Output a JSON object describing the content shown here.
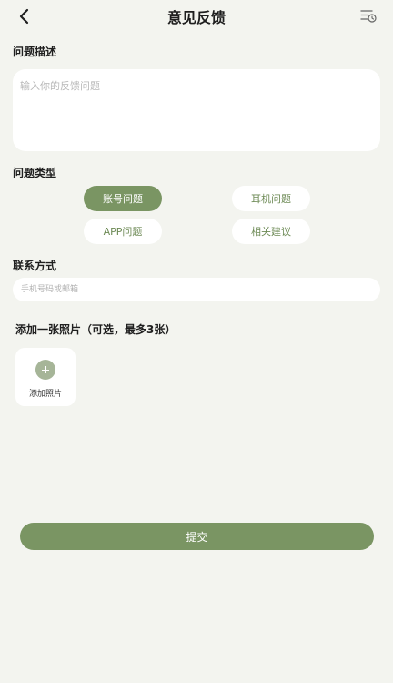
{
  "header": {
    "title": "意见反馈"
  },
  "description": {
    "label": "问题描述",
    "placeholder": "输入你的反馈问题",
    "value": ""
  },
  "issue_type": {
    "label": "问题类型",
    "options": [
      {
        "label": "账号问题",
        "selected": true
      },
      {
        "label": "耳机问题",
        "selected": false
      },
      {
        "label": "APP问题",
        "selected": false
      },
      {
        "label": "相关建议",
        "selected": false
      }
    ]
  },
  "contact": {
    "label": "联系方式",
    "placeholder": "手机号码或邮箱",
    "value": ""
  },
  "photos": {
    "label": "添加一张照片（可选，最多3张）",
    "add_label": "添加照片"
  },
  "submit_label": "提交",
  "colors": {
    "background": "#f3f4ef",
    "accent": "#7a9563",
    "accent_text": "#6d8a55",
    "surface": "#ffffff"
  },
  "icons": {
    "back": "back-arrow-icon",
    "history": "list-clock-icon",
    "plus": "plus-icon"
  }
}
